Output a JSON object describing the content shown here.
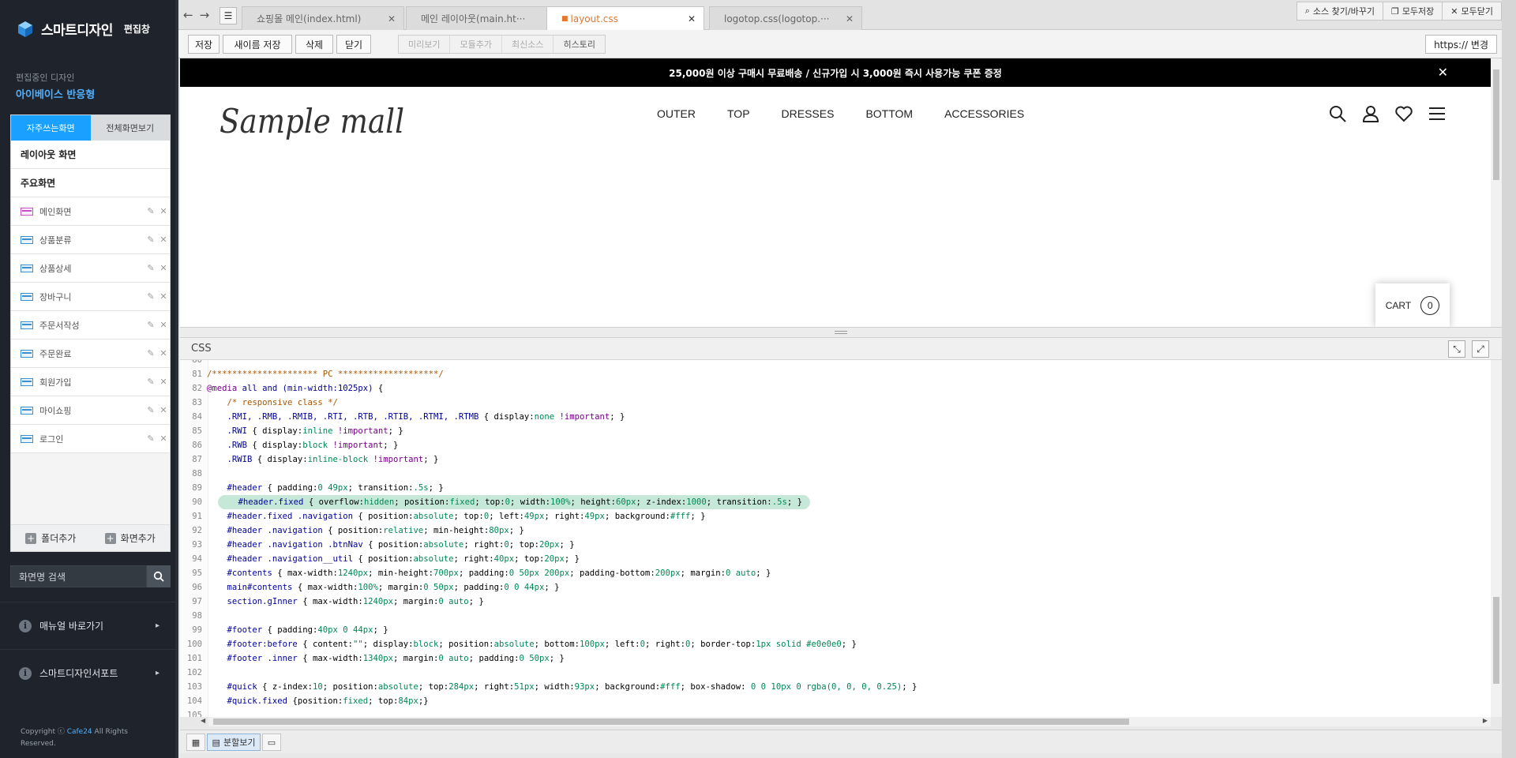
{
  "sidebar": {
    "brand_title": "스마트디자인",
    "brand_sub": "편집창",
    "current_label": "편집중인 디자인",
    "current_design": "아이베이스 반응형",
    "tabs": [
      "자주쓰는화면",
      "전체화면보기"
    ],
    "groups": [
      "레이아웃 화면",
      "주요화면"
    ],
    "pages": [
      "메인화면",
      "상품분류",
      "상품상세",
      "장바구니",
      "주문서작성",
      "주문완료",
      "회원가입",
      "마이쇼핑",
      "로그인"
    ],
    "add_folder": "폴더추가",
    "add_page": "화면추가",
    "search_placeholder": "화면명 검색",
    "links": [
      "매뉴얼 바로가기",
      "스마트디자인서포트"
    ],
    "copyright_prefix": "Copyright ⓒ ",
    "copyright_brand": "Cafe24",
    "copyright_suffix": " All Rights Reserved."
  },
  "tabbar": {
    "tabs": [
      {
        "label": "쇼핑몰 메인(index.html)",
        "active": false
      },
      {
        "label": "메인 레이아웃(main.ht···",
        "active": false
      },
      {
        "label": "layout.css",
        "active": true
      },
      {
        "label": "logotop.css(logotop.···",
        "active": false
      }
    ],
    "tools": [
      "소스 찾기/바꾸기",
      "모두저장",
      "모두닫기"
    ]
  },
  "toolbar": {
    "buttons": [
      "저장",
      "새이름 저장",
      "삭제",
      "닫기"
    ],
    "disabled": [
      "미리보기",
      "모듈추가",
      "최신소스",
      "히스토리"
    ],
    "https": "https:// 변경"
  },
  "preview": {
    "banner": "25,000원 이상 구매시 무료배송 / 신규가입 시 3,000원 즉시 사용가능 쿠폰 증정",
    "logo": "Sample mall",
    "nav": [
      "OUTER",
      "TOP",
      "DRESSES",
      "BOTTOM",
      "ACCESSORIES"
    ],
    "cart_label": "CART",
    "cart_count": "0"
  },
  "editor": {
    "title": "CSS",
    "highlight_line": 90,
    "lines": [
      {
        "n": "80",
        "t": ""
      },
      {
        "n": "81",
        "t": "/********************* PC ********************/"
      },
      {
        "n": "82",
        "t": "@media all and (min-width:1025px) {"
      },
      {
        "n": "83",
        "t": "    /* responsive class */"
      },
      {
        "n": "84",
        "t": "    .RMI, .RMB, .RMIB, .RTI, .RTB, .RTIB, .RTMI, .RTMB { display:none !important; }"
      },
      {
        "n": "85",
        "t": "    .RWI { display:inline !important; }"
      },
      {
        "n": "86",
        "t": "    .RWB { display:block !important; }"
      },
      {
        "n": "87",
        "t": "    .RWIB { display:inline-block !important; }"
      },
      {
        "n": "88",
        "t": ""
      },
      {
        "n": "89",
        "t": "    #header { padding:0 49px; transition:.5s; }"
      },
      {
        "n": "90",
        "t": "    #header.fixed { overflow:hidden; position:fixed; top:0; width:100%; height:60px; z-index:1000; transition:.5s; }"
      },
      {
        "n": "91",
        "t": "    #header.fixed .navigation { position:absolute; top:0; left:49px; right:49px; background:#fff; }"
      },
      {
        "n": "92",
        "t": "    #header .navigation { position:relative; min-height:80px; }"
      },
      {
        "n": "93",
        "t": "    #header .navigation .btnNav { position:absolute; right:0; top:20px; }"
      },
      {
        "n": "94",
        "t": "    #header .navigation__util { position:absolute; right:40px; top:20px; }"
      },
      {
        "n": "95",
        "t": "    #contents { max-width:1240px; min-height:700px; padding:0 50px 200px; padding-bottom:200px; margin:0 auto; }"
      },
      {
        "n": "96",
        "t": "    main#contents { max-width:100%; margin:0 50px; padding:0 0 44px; }"
      },
      {
        "n": "97",
        "t": "    section.gInner { max-width:1240px; margin:0 auto; }"
      },
      {
        "n": "98",
        "t": ""
      },
      {
        "n": "99",
        "t": "    #footer { padding:40px 0 44px; }"
      },
      {
        "n": "100",
        "t": "    #footer:before { content:\"\"; display:block; position:absolute; bottom:100px; left:0; right:0; border-top:1px solid #e0e0e0; }"
      },
      {
        "n": "101",
        "t": "    #footer .inner { max-width:1340px; margin:0 auto; padding:0 50px; }"
      },
      {
        "n": "102",
        "t": ""
      },
      {
        "n": "103",
        "t": "    #quick { z-index:10; position:absolute; top:284px; right:51px; width:93px; background:#fff; box-shadow: 0 0 10px 0 rgba(0, 0, 0, 0.25); }"
      },
      {
        "n": "104",
        "t": "    #quick.fixed {position:fixed; top:84px;}"
      },
      {
        "n": "105",
        "t": ""
      }
    ]
  },
  "statusbar": {
    "split_label": "분할보기"
  },
  "colors": {
    "accent": "#1aa1ff",
    "active_tab": "#e7762a",
    "sidebar_bg": "#1f242c",
    "highlight": "#c6e8d8"
  }
}
